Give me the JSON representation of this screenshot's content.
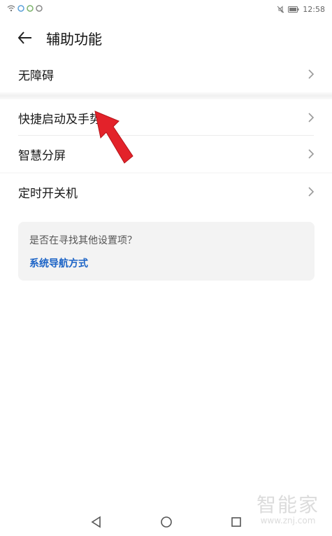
{
  "status_bar": {
    "time": "12:58"
  },
  "header": {
    "title": "辅助功能"
  },
  "settings": {
    "groups": [
      {
        "items": [
          {
            "label": "无障碍"
          }
        ]
      },
      {
        "items": [
          {
            "label": "快捷启动及手势"
          },
          {
            "label": "智慧分屏"
          }
        ]
      },
      {
        "items": [
          {
            "label": "定时开关机"
          }
        ]
      }
    ]
  },
  "suggestion": {
    "question": "是否在寻找其他设置项？",
    "link": "系统导航方式"
  },
  "watermark": {
    "brand": "智能家",
    "url": "www.znj.com"
  },
  "colors": {
    "accent_link": "#1b63c6",
    "annotation_arrow": "#e3222a"
  },
  "icons": {
    "back": "arrow-left-icon",
    "chevron": "chevron-right-icon",
    "nav": [
      "back-triangle-icon",
      "home-circle-icon",
      "recents-square-icon"
    ]
  }
}
